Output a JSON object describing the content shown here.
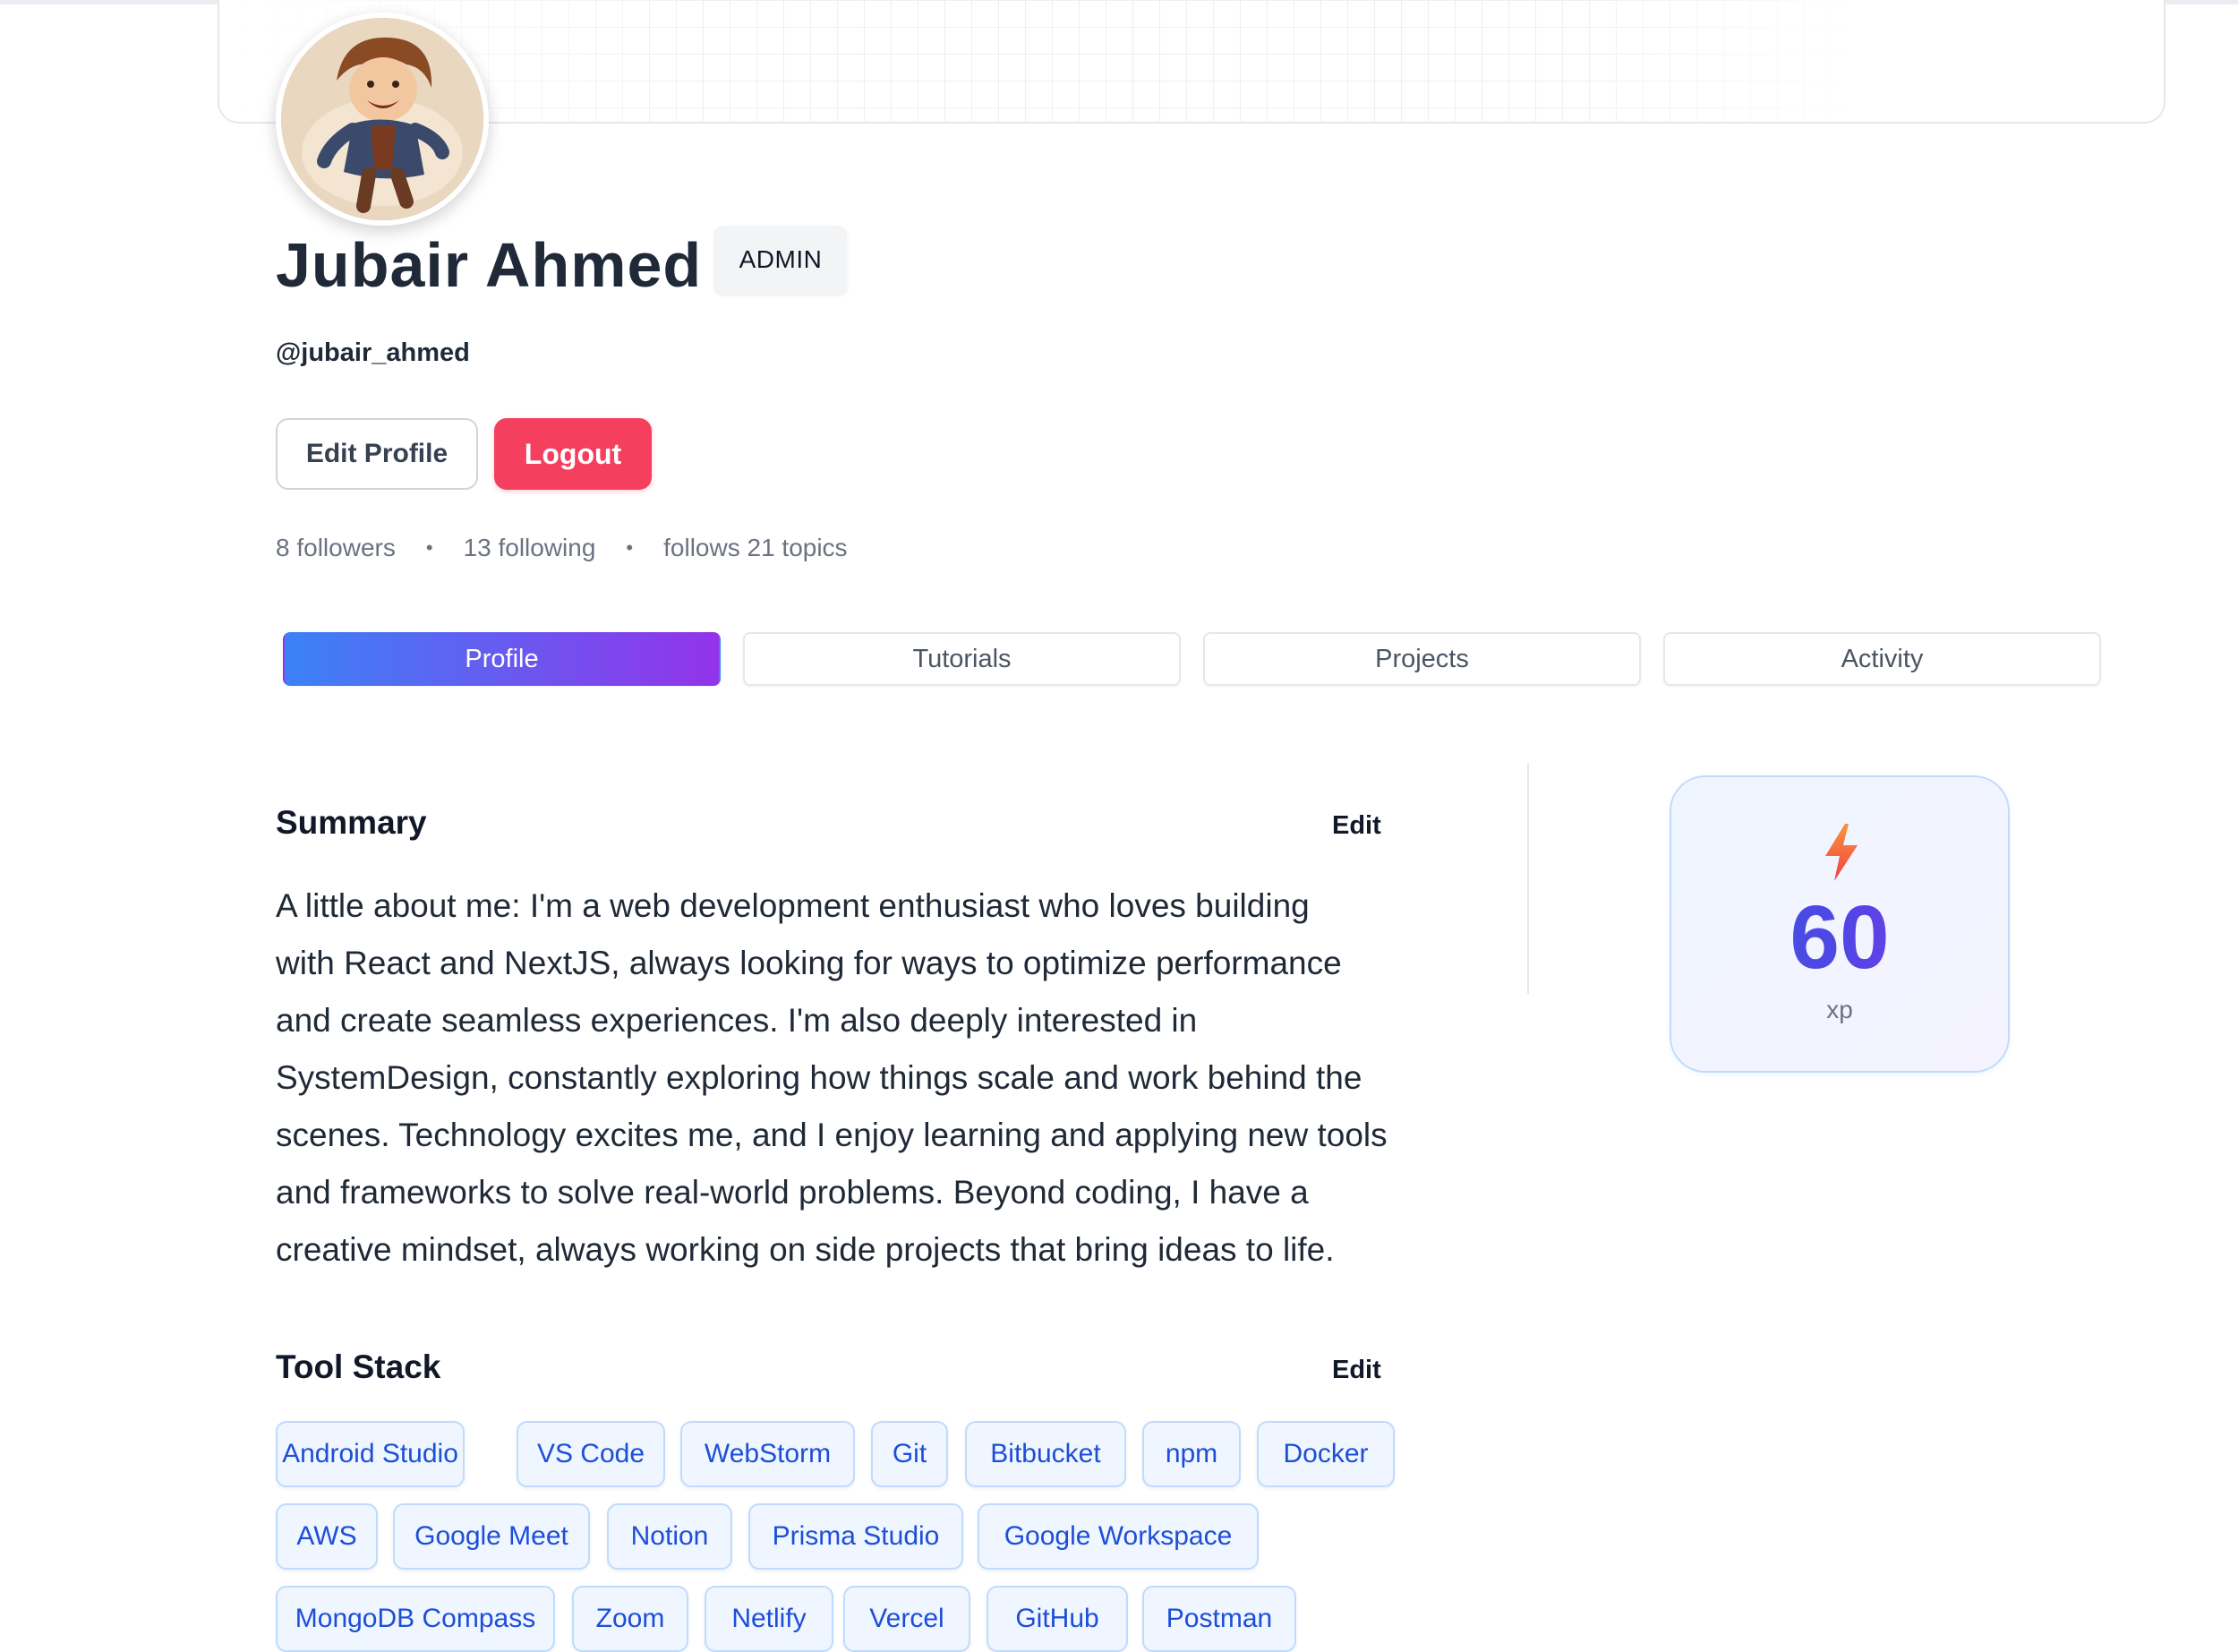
{
  "profile": {
    "name": "Jubair Ahmed",
    "role_badge": "ADMIN",
    "handle": "@jubair_ahmed",
    "edit_profile_label": "Edit Profile",
    "logout_label": "Logout",
    "followers": "8 followers",
    "following": "13 following",
    "topics": "follows 21 topics",
    "separator": "•"
  },
  "tabs": [
    {
      "label": "Profile",
      "active": true
    },
    {
      "label": "Tutorials",
      "active": false
    },
    {
      "label": "Projects",
      "active": false
    },
    {
      "label": "Activity",
      "active": false
    }
  ],
  "summary": {
    "title": "Summary",
    "edit_label": "Edit",
    "lines": [
      "A little about me: I'm a web development enthusiast who loves building",
      "with React and NextJS, always looking for ways to optimize performance",
      "and create seamless experiences. I'm also deeply interested in",
      "SystemDesign, constantly exploring how things scale and work behind the",
      "scenes. Technology excites me, and I enjoy learning and applying new tools",
      "and frameworks to solve real-world problems. Beyond coding, I have a",
      "creative mindset, always working on side projects that bring ideas to life."
    ]
  },
  "xp": {
    "value": "60",
    "unit": "xp",
    "icon": "lightning-bolt-icon"
  },
  "tool_stack": {
    "title": "Tool Stack",
    "edit_label": "Edit",
    "rows": [
      [
        "Android Studio",
        "VS Code",
        "WebStorm",
        "Git",
        "Bitbucket",
        "npm",
        "Docker"
      ],
      [
        "AWS",
        "Google Meet",
        "Notion",
        "Prisma Studio",
        "Google Workspace"
      ],
      [
        "MongoDB Compass",
        "Zoom",
        "Netlify",
        "Vercel",
        "GitHub",
        "Postman"
      ]
    ]
  },
  "colors": {
    "logout": "#f43f5e",
    "tab_gradient_start": "#3b82f6",
    "tab_gradient_end": "#9333ea",
    "tool_text": "#1d4ed8",
    "tool_bg": "#eff6ff"
  }
}
